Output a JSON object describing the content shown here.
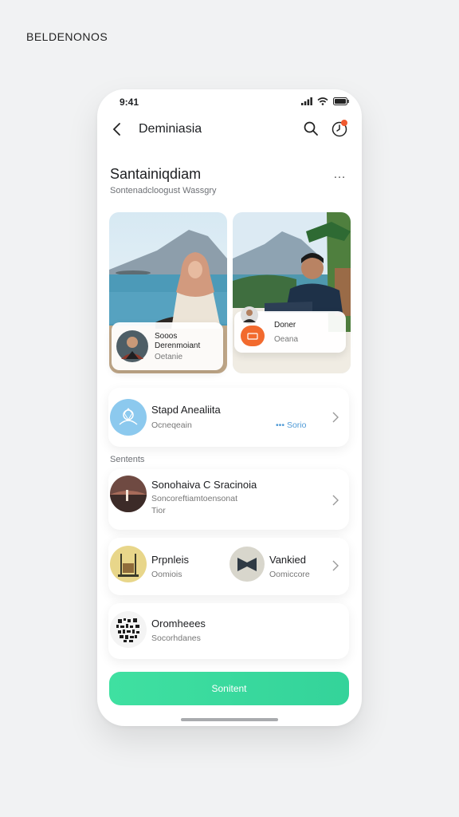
{
  "brand": "BELDENONOS",
  "status": {
    "time": "9:41"
  },
  "nav": {
    "title": "Deminiasia"
  },
  "section": {
    "title": "Santainiqdiam",
    "subtitle": "Sontenadcloogust Wassgry",
    "more": "…"
  },
  "photo_cards": [
    {
      "name": "Sooos Derenmoiant",
      "sub": "Oetanie"
    },
    {
      "name": "Doner",
      "sub": "Oeana"
    }
  ],
  "cards": {
    "profile": {
      "title": "Stapd Anealiita",
      "sub": "Ocneqeain",
      "link": "••• Sorio"
    },
    "label": "Sentents",
    "event": {
      "title": "Sonohaiva C Sracinoia",
      "sub": "Soncoreftiamtoensonat",
      "sub2": "Tior"
    },
    "pair": {
      "left_title": "Prpnleis",
      "left_sub": "Oomiois",
      "right_title": "Vankied",
      "right_sub": "Oomiccore"
    },
    "code": {
      "title": "Oromheees",
      "sub": "Socorhdanes"
    }
  },
  "cta": {
    "label": "Sonitent"
  },
  "colors": {
    "accent": "#37d69c",
    "badge": "#f0592f",
    "avatar_blue": "#8cc9ee"
  }
}
